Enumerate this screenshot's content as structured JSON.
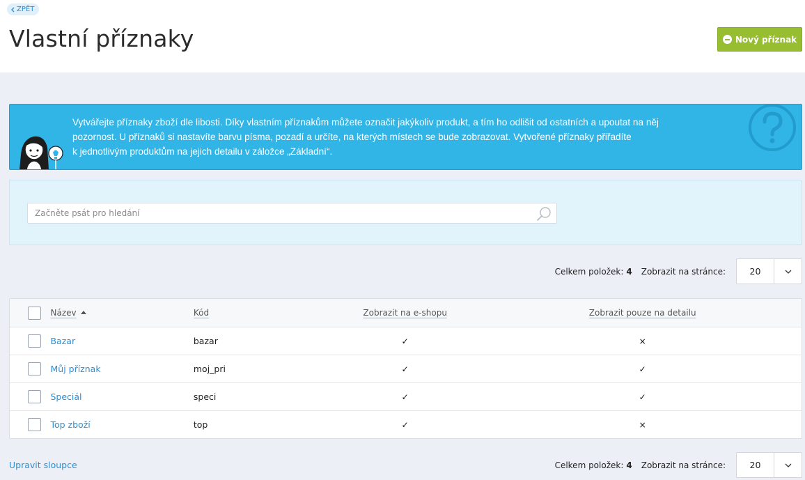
{
  "header": {
    "back_label": "ZPĚT",
    "title": "Vlastní příznaky",
    "new_button_label": "Nový příznak"
  },
  "banner": {
    "lines": [
      "Vytvářejte příznaky zboží dle libosti. Díky vlastním příznakům můžete označit jakýkoliv produkt, a tím ho odlišit od ostatních a upoutat na něj",
      "pozornost. U příznaků si nastavíte barvu písma, pozadí a určíte, na kterých místech se bude zobrazovat. Vytvořené příznaky přiřadíte",
      "k jednotlivým produktům na jejich detailu v záložce „Základní“."
    ]
  },
  "search": {
    "placeholder": "Začněte psát pro hledání",
    "value": ""
  },
  "pager": {
    "total_label": "Celkem položek:",
    "total_count": "4",
    "per_page_label": "Zobrazit na stránce:",
    "per_page_value": "20"
  },
  "table": {
    "columns": {
      "name": "Název",
      "code": "Kód",
      "show_eshop": "Zobrazit na e-shopu",
      "detail_only": "Zobrazit pouze na detailu"
    },
    "rows": [
      {
        "name": "Bazar",
        "code": "bazar",
        "show_eshop": "✓",
        "detail_only": "×"
      },
      {
        "name": "Můj příznak",
        "code": "moj_pri",
        "show_eshop": "✓",
        "detail_only": "✓"
      },
      {
        "name": "Speciál",
        "code": "speci",
        "show_eshop": "✓",
        "detail_only": "✓"
      },
      {
        "name": "Top zboží",
        "code": "top",
        "show_eshop": "✓",
        "detail_only": "×"
      }
    ]
  },
  "footer": {
    "edit_columns_label": "Upravit sloupce"
  },
  "colors": {
    "accent_blue": "#2c8fd3",
    "banner_blue": "#31b4e6",
    "primary_green": "#97be31"
  },
  "icons": {
    "back": "chevron-left-icon",
    "new": "minus-circle-icon",
    "help": "question-circle-icon",
    "mascot": "girl-lightbulb-icon",
    "search": "search-icon",
    "dropdown": "chevron-down-icon"
  }
}
